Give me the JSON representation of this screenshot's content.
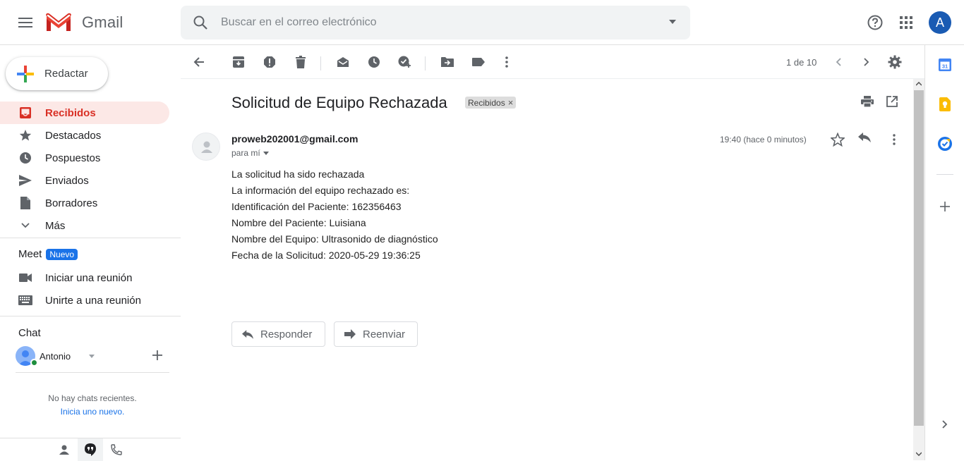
{
  "app": {
    "name": "Gmail"
  },
  "search": {
    "placeholder": "Buscar en el correo electrónico"
  },
  "account": {
    "initial": "A",
    "color": "#1a5bb3"
  },
  "compose": {
    "label": "Redactar"
  },
  "nav": {
    "items": [
      {
        "label": "Recibidos",
        "icon": "inbox-icon",
        "active": true
      },
      {
        "label": "Destacados",
        "icon": "star-icon"
      },
      {
        "label": "Pospuestos",
        "icon": "clock-icon"
      },
      {
        "label": "Enviados",
        "icon": "send-icon"
      },
      {
        "label": "Borradores",
        "icon": "draft-icon"
      },
      {
        "label": "Más",
        "icon": "chevron-down-icon"
      }
    ]
  },
  "meet": {
    "title": "Meet",
    "badge": "Nuevo",
    "items": [
      {
        "label": "Iniciar una reunión",
        "icon": "video-camera-icon"
      },
      {
        "label": "Unirte a una reunión",
        "icon": "keyboard-icon"
      }
    ]
  },
  "chat": {
    "title": "Chat",
    "user": "Antonio",
    "empty_text": "No hay chats recientes.",
    "start_link": "Inicia uno nuevo."
  },
  "toolbar": {
    "pager": "1 de 10"
  },
  "email": {
    "subject": "Solicitud de Equipo Rechazada",
    "label_chip": "Recibidos",
    "sender": "proweb202001@gmail.com",
    "recipient": "para mí",
    "time": "19:40 (hace 0 minutos)",
    "body": [
      "La solicitud ha sido rechazada",
      "La información del equipo rechazado es:",
      "Identificación del Paciente: 162356463",
      "Nombre del Paciente: Luisiana",
      "Nombre del Equipo: Ultrasonido de diagnóstico",
      "Fecha de la Solicitud: 2020-05-29 19:36:25"
    ],
    "reply_label": "Responder",
    "forward_label": "Reenviar"
  },
  "colors": {
    "accent_red": "#d93025",
    "active_bg": "#fce8e6",
    "link_blue": "#1a73e8",
    "online_green": "#1e8e3e"
  }
}
